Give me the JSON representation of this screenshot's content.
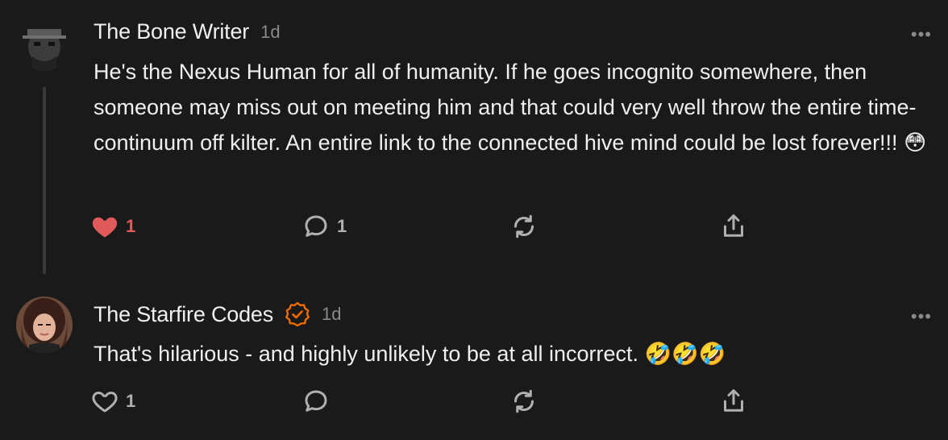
{
  "comments": [
    {
      "author": "The Bone Writer",
      "time": "1d",
      "text": "He's the Nexus Human for all of humanity. If he goes incognito somewhere, then someone may miss out on meeting him and that could very well throw the entire time-continuum off kilter. An entire link to the connected hive mind could be lost forever!!! 😳",
      "verified": false,
      "liked": true,
      "like_count": "1",
      "reply_count": "1",
      "more_label": "•••"
    },
    {
      "author": "The Starfire Codes",
      "time": "1d",
      "text": "That's hilarious - and highly unlikely to be at all incorrect. 🤣🤣🤣",
      "verified": true,
      "liked": false,
      "like_count": "1",
      "reply_count": "",
      "more_label": "•••"
    }
  ],
  "colors": {
    "background": "#1a1a1b",
    "liked": "#e05a5a",
    "verified": "#ef6c00",
    "muted": "#8a8a8e"
  },
  "icons": [
    "heart-icon",
    "comment-bubble-icon",
    "restack-icon",
    "share-icon",
    "verified-badge-icon",
    "more-icon"
  ]
}
